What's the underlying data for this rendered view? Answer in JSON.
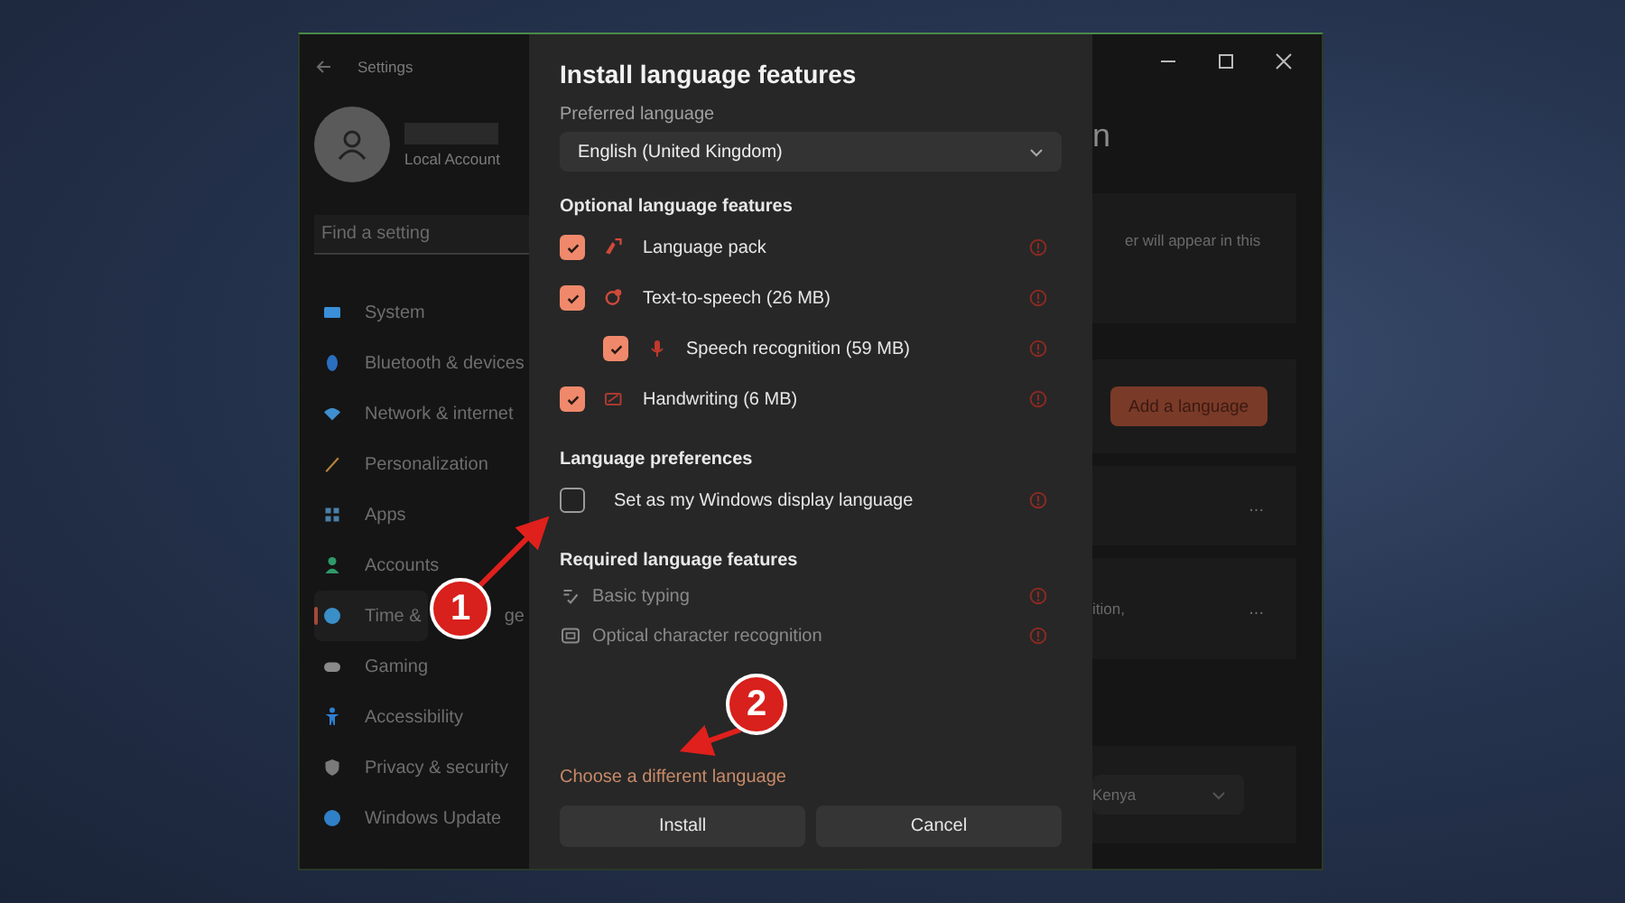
{
  "settings_window": {
    "title": "Settings",
    "account": {
      "type": "Local Account"
    },
    "search": {
      "placeholder": "Find a setting"
    },
    "sidebar": {
      "items": [
        {
          "label": "System",
          "selected": false,
          "color": "#3a8fd8"
        },
        {
          "label": "Bluetooth & devices",
          "selected": false,
          "color": "#2a6fc0"
        },
        {
          "label": "Network & internet",
          "selected": false,
          "color": "#3f8fd0"
        },
        {
          "label": "Personalization",
          "selected": false,
          "color": "#b8863a"
        },
        {
          "label": "Apps",
          "selected": false,
          "color": "#4a7fa8"
        },
        {
          "label": "Accounts",
          "selected": false,
          "color": "#2e9a6a"
        },
        {
          "label": "Time &",
          "label_after_badge": "ge",
          "selected": true,
          "color": "#3a8fc8"
        },
        {
          "label": "Gaming",
          "selected": false,
          "color": "#8a8a8a"
        },
        {
          "label": "Accessibility",
          "selected": false,
          "color": "#2f7fd0"
        },
        {
          "label": "Privacy & security",
          "selected": false,
          "color": "#7a7a7a"
        },
        {
          "label": "Windows Update",
          "selected": false,
          "color": "#2f80c8"
        }
      ]
    },
    "page_heading": "n",
    "cards": [
      {
        "text": "er will appear in this"
      },
      {
        "button": "Add a language"
      },
      {
        "more": "..."
      },
      {
        "text": "ition,",
        "more": "..."
      },
      {
        "dropdown": "Kenya"
      }
    ]
  },
  "dialog": {
    "title": "Install language features",
    "preferred_language": {
      "label": "Preferred language",
      "value": "English (United Kingdom)"
    },
    "optional_features": {
      "heading": "Optional language features",
      "items": [
        {
          "label": "Language pack",
          "checked": true
        },
        {
          "label": "Text-to-speech (26 MB)",
          "checked": true,
          "children": [
            {
              "label": "Speech recognition (59 MB)",
              "checked": true
            }
          ]
        },
        {
          "label": "Handwriting (6 MB)",
          "checked": true
        }
      ]
    },
    "language_preferences": {
      "heading": "Language preferences",
      "items": [
        {
          "label": "Set as my Windows display language",
          "checked": false
        }
      ]
    },
    "required_features": {
      "heading": "Required language features",
      "items": [
        {
          "label": "Basic typing"
        },
        {
          "label": "Optical character recognition"
        }
      ]
    },
    "link": "Choose a different language",
    "buttons": [
      "Install",
      "Cancel"
    ]
  },
  "annotations": [
    {
      "number": "1"
    },
    {
      "number": "2"
    }
  ]
}
